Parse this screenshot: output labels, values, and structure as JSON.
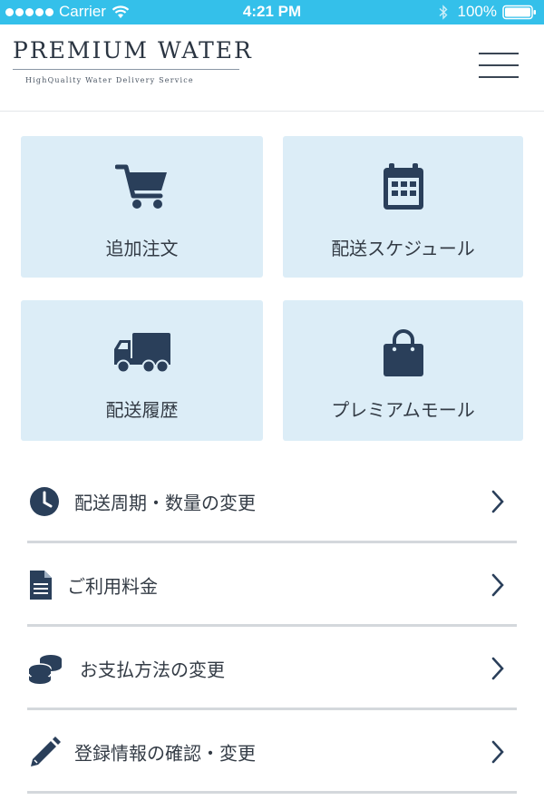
{
  "status_bar": {
    "carrier": "Carrier",
    "time": "4:21 PM",
    "battery": "100%"
  },
  "header": {
    "logo_title": "PREMIUM WATER",
    "logo_tagline": "HighQuality   Water   Delivery   Service"
  },
  "tiles": [
    {
      "label": "追加注文",
      "icon": "cart-icon"
    },
    {
      "label": "配送スケジュール",
      "icon": "calendar-icon"
    },
    {
      "label": "配送履歴",
      "icon": "truck-icon"
    },
    {
      "label": "プレミアムモール",
      "icon": "shopping-bag-icon"
    }
  ],
  "menu_items": [
    {
      "label": "配送周期・数量の変更",
      "icon": "clock-icon"
    },
    {
      "label": "ご利用料金",
      "icon": "document-icon"
    },
    {
      "label": "お支払方法の変更",
      "icon": "coins-icon"
    },
    {
      "label": "登録情報の確認・変更",
      "icon": "pencil-icon"
    }
  ],
  "colors": {
    "status_bar": "#34c0ea",
    "tile_bg": "#dcedf7",
    "icon": "#2a3f5a",
    "text": "#333b45"
  }
}
